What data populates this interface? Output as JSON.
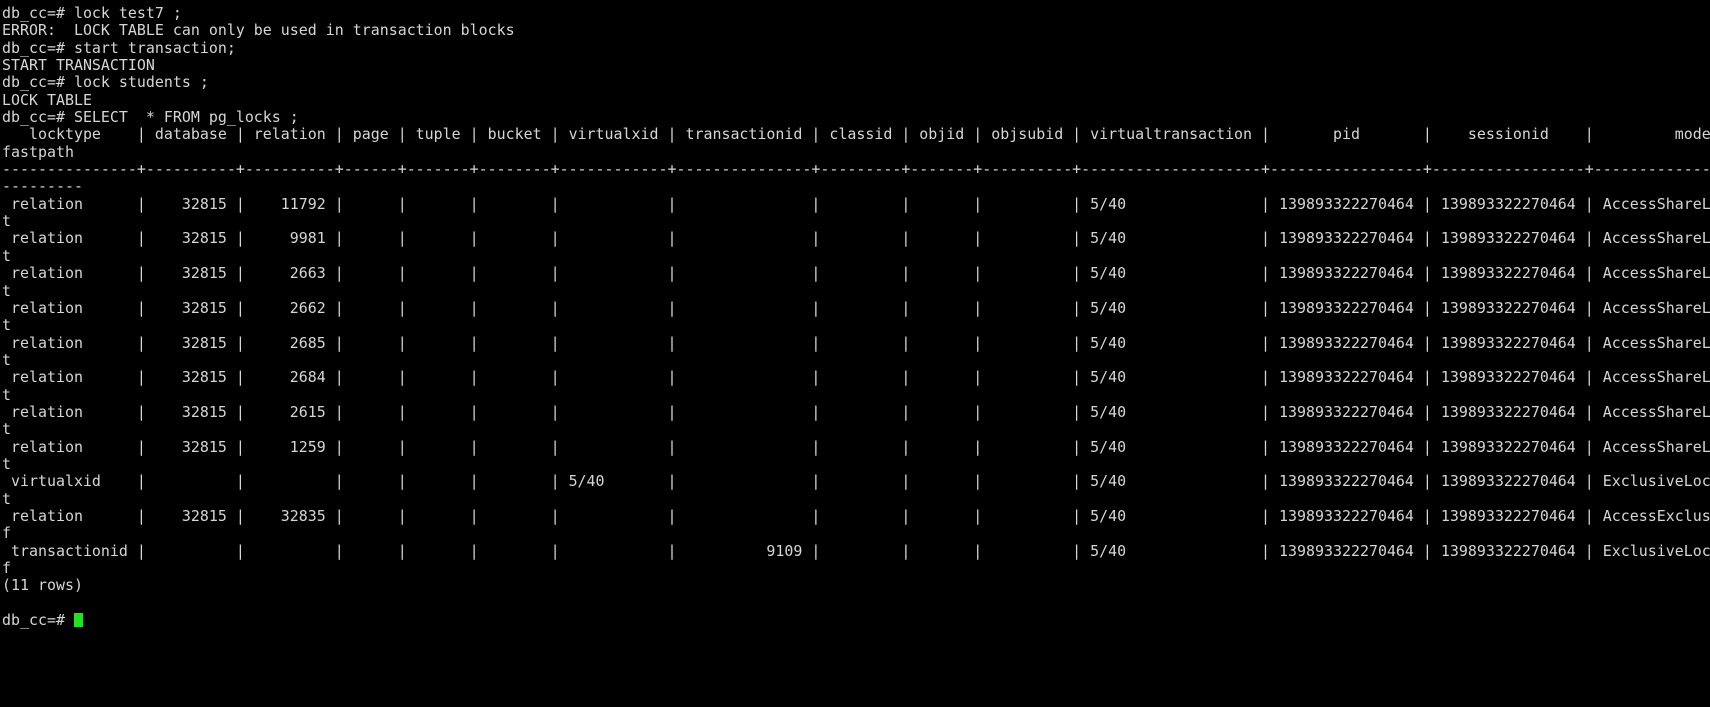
{
  "terminal": {
    "kind": "psql-session",
    "colors": {
      "background": "#000000",
      "foreground": "#d6d6d6",
      "cursor": "#21e421"
    },
    "prompt": "db_cc=# ",
    "columns": 190,
    "lines": [
      "db_cc=# lock test7 ;",
      "ERROR:  LOCK TABLE can only be used in transaction blocks",
      "db_cc=# start transaction;",
      "START TRANSACTION",
      "db_cc=# lock students ;",
      "LOCK TABLE",
      "db_cc=# SELECT  * FROM pg_locks ;",
      "   locktype    | database | relation | page | tuple | bucket | virtualxid | transactionid | classid | objid | objsubid | virtualtransaction |       pid       |    sessionid    |         mode",
      "fastpath",
      "---------------+----------+----------+------+-------+--------+------------+---------------+---------+-------+----------+--------------------+-----------------+-----------------+--------------------",
      "---------",
      " relation      |    32815 |    11792 |      |       |        |            |               |         |       |          | 5/40               | 139893322270464 | 139893322270464 | AccessShareLock",
      "t",
      " relation      |    32815 |     9981 |      |       |        |            |               |         |       |          | 5/40               | 139893322270464 | 139893322270464 | AccessShareLock",
      "t",
      " relation      |    32815 |     2663 |      |       |        |            |               |         |       |          | 5/40               | 139893322270464 | 139893322270464 | AccessShareLock",
      "t",
      " relation      |    32815 |     2662 |      |       |        |            |               |         |       |          | 5/40               | 139893322270464 | 139893322270464 | AccessShareLock",
      "t",
      " relation      |    32815 |     2685 |      |       |        |            |               |         |       |          | 5/40               | 139893322270464 | 139893322270464 | AccessShareLock",
      "t",
      " relation      |    32815 |     2684 |      |       |        |            |               |         |       |          | 5/40               | 139893322270464 | 139893322270464 | AccessShareLock",
      "t",
      " relation      |    32815 |     2615 |      |       |        |            |               |         |       |          | 5/40               | 139893322270464 | 139893322270464 | AccessShareLock",
      "t",
      " relation      |    32815 |     1259 |      |       |        |            |               |         |       |          | 5/40               | 139893322270464 | 139893322270464 | AccessShareLock",
      "t",
      " virtualxid    |          |          |      |       |        | 5/40       |               |         |       |          | 5/40               | 139893322270464 | 139893322270464 | ExclusiveLock",
      "t",
      " relation      |    32815 |    32835 |      |       |        |            |               |         |       |          | 5/40               | 139893322270464 | 139893322270464 | AccessExclusiveLock",
      "f",
      " transactionid |          |          |      |       |        |            |          9109 |         |       |          | 5/40               | 139893322270464 | 139893322270464 | ExclusiveLock",
      "f",
      "(11 rows)",
      "",
      "db_cc=# "
    ],
    "table": {
      "query": "SELECT  * FROM pg_locks ;",
      "headers": [
        "locktype",
        "database",
        "relation",
        "page",
        "tuple",
        "bucket",
        "virtualxid",
        "transactionid",
        "classid",
        "objid",
        "objsubid",
        "virtualtransaction",
        "pid",
        "sessionid",
        "mode",
        "fastpath"
      ],
      "rows": [
        [
          "relation",
          "32815",
          "11792",
          "",
          "",
          "",
          "",
          "",
          "",
          "",
          "",
          "5/40",
          "139893322270464",
          "139893322270464",
          "AccessShareLock",
          "t"
        ],
        [
          "relation",
          "32815",
          "9981",
          "",
          "",
          "",
          "",
          "",
          "",
          "",
          "",
          "5/40",
          "139893322270464",
          "139893322270464",
          "AccessShareLock",
          "t"
        ],
        [
          "relation",
          "32815",
          "2663",
          "",
          "",
          "",
          "",
          "",
          "",
          "",
          "",
          "5/40",
          "139893322270464",
          "139893322270464",
          "AccessShareLock",
          "t"
        ],
        [
          "relation",
          "32815",
          "2662",
          "",
          "",
          "",
          "",
          "",
          "",
          "",
          "",
          "5/40",
          "139893322270464",
          "139893322270464",
          "AccessShareLock",
          "t"
        ],
        [
          "relation",
          "32815",
          "2685",
          "",
          "",
          "",
          "",
          "",
          "",
          "",
          "",
          "5/40",
          "139893322270464",
          "139893322270464",
          "AccessShareLock",
          "t"
        ],
        [
          "relation",
          "32815",
          "2684",
          "",
          "",
          "",
          "",
          "",
          "",
          "",
          "",
          "5/40",
          "139893322270464",
          "139893322270464",
          "AccessShareLock",
          "t"
        ],
        [
          "relation",
          "32815",
          "2615",
          "",
          "",
          "",
          "",
          "",
          "",
          "",
          "",
          "5/40",
          "139893322270464",
          "139893322270464",
          "AccessShareLock",
          "t"
        ],
        [
          "relation",
          "32815",
          "1259",
          "",
          "",
          "",
          "",
          "",
          "",
          "",
          "",
          "5/40",
          "139893322270464",
          "139893322270464",
          "AccessShareLock",
          "t"
        ],
        [
          "virtualxid",
          "",
          "",
          "",
          "",
          "",
          "5/40",
          "",
          "",
          "",
          "",
          "5/40",
          "139893322270464",
          "139893322270464",
          "ExclusiveLock",
          "t"
        ],
        [
          "relation",
          "32815",
          "32835",
          "",
          "",
          "",
          "",
          "",
          "",
          "",
          "",
          "5/40",
          "139893322270464",
          "139893322270464",
          "AccessExclusiveLock",
          "f"
        ],
        [
          "transactionid",
          "",
          "",
          "",
          "",
          "",
          "",
          "9109",
          "",
          "",
          "",
          "5/40",
          "139893322270464",
          "139893322270464",
          "ExclusiveLock",
          "f"
        ]
      ],
      "row_count_label": "(11 rows)"
    }
  }
}
